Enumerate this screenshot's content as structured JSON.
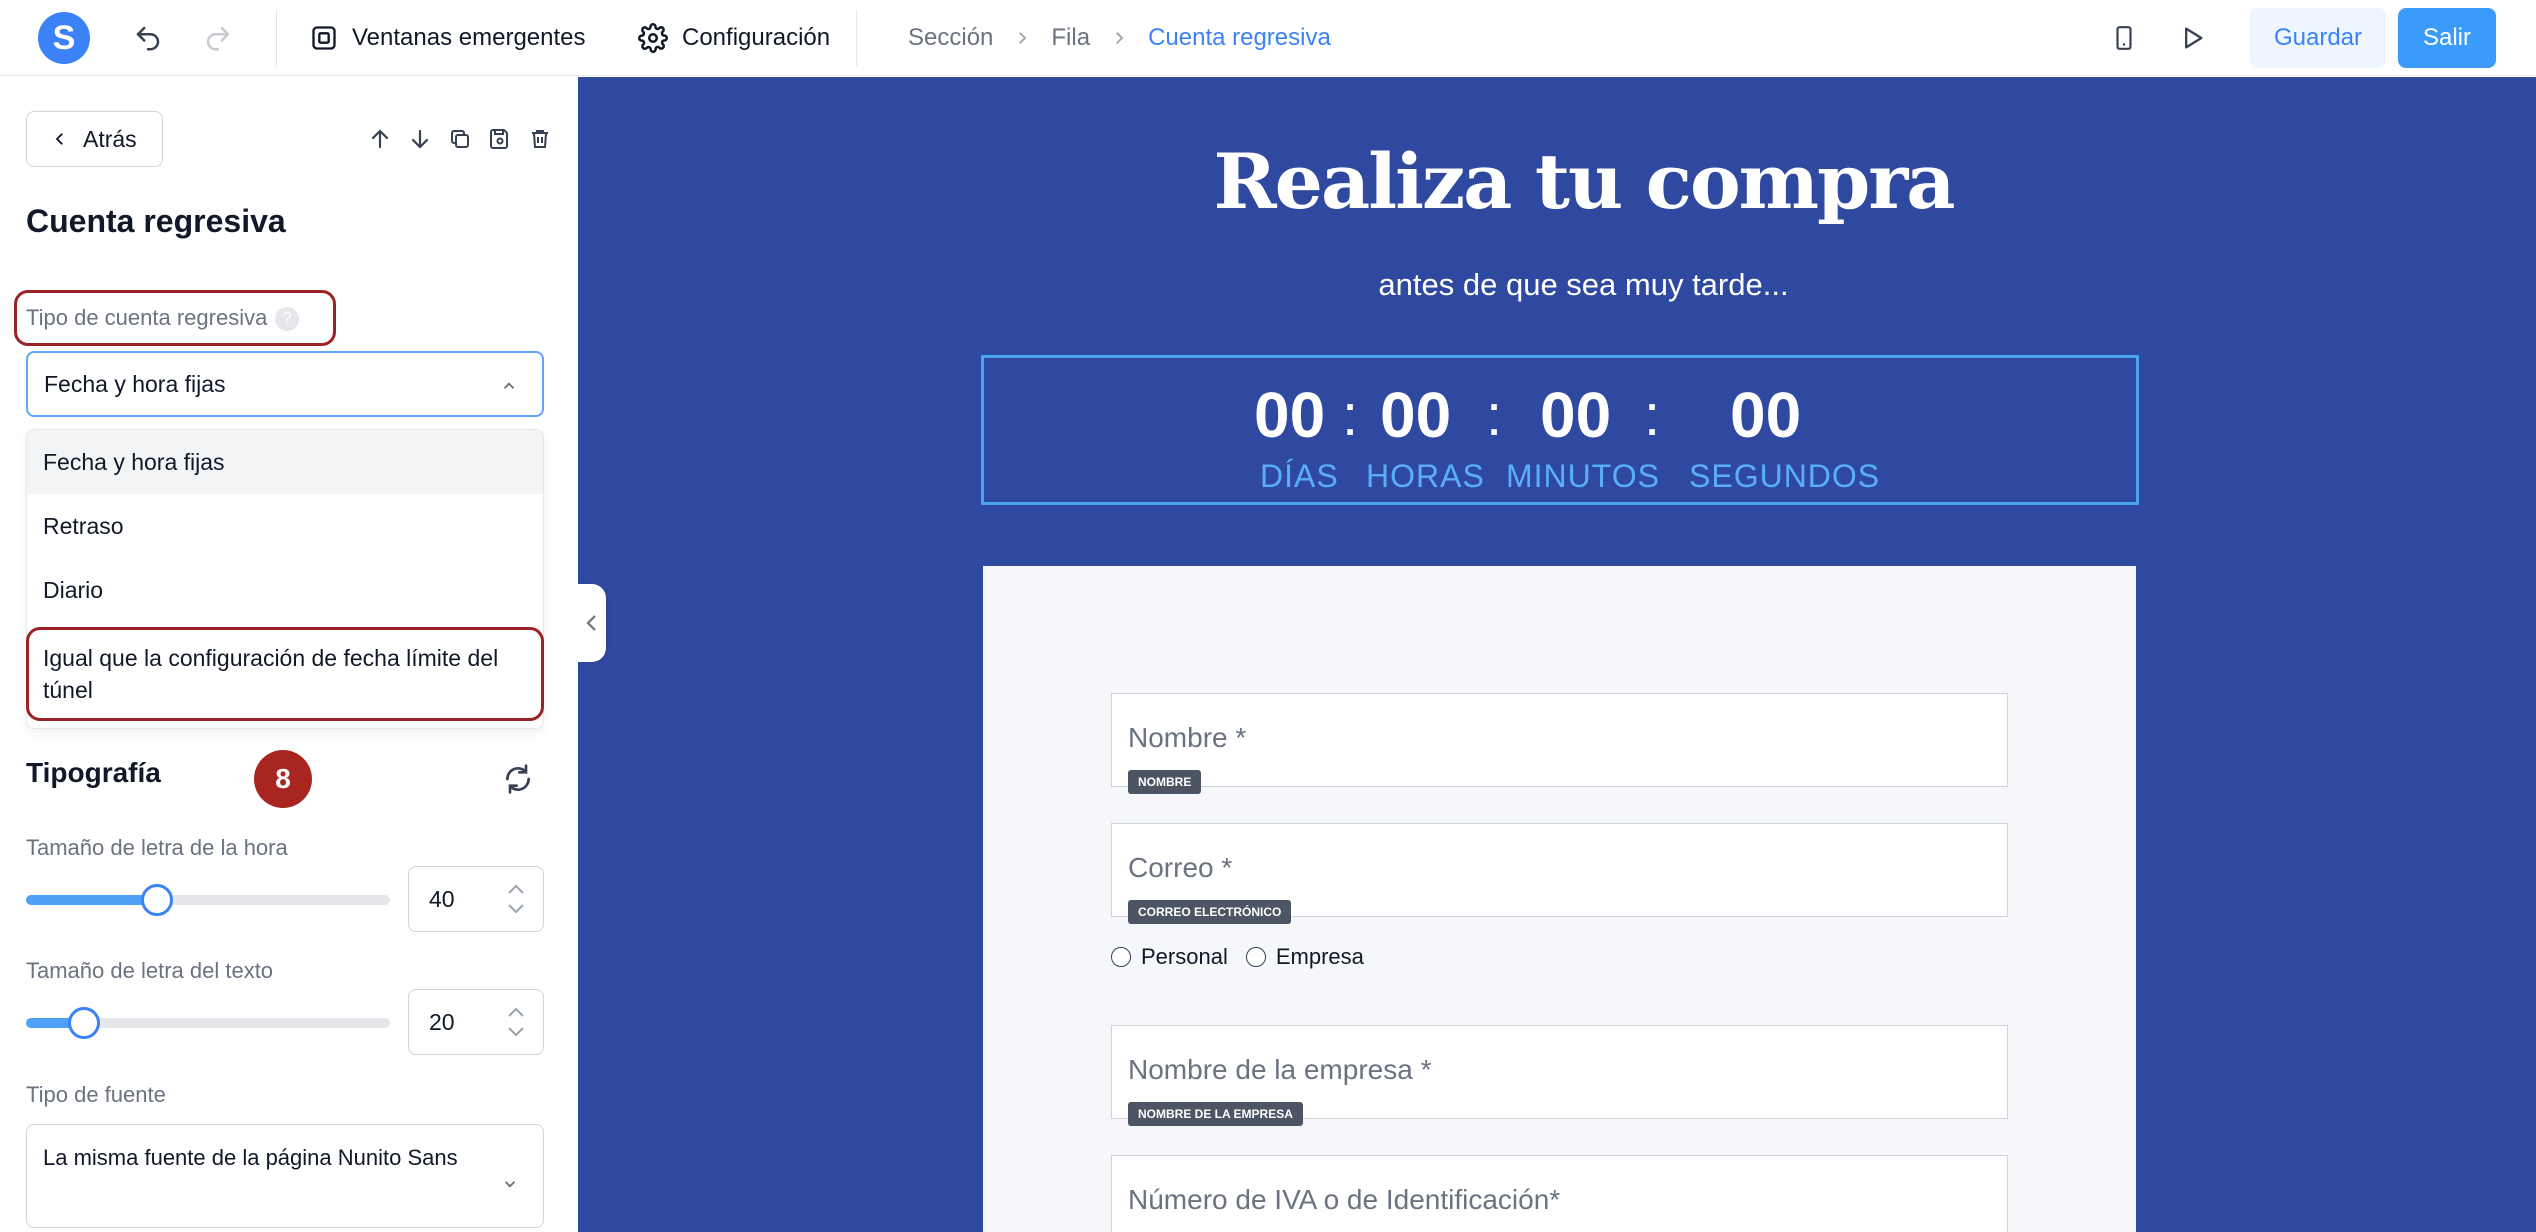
{
  "topbar": {
    "logo_letter": "S",
    "popups_label": "Ventanas emergentes",
    "settings_label": "Configuración",
    "breadcrumb": [
      "Sección",
      "Fila",
      "Cuenta regresiva"
    ],
    "save_label": "Guardar",
    "exit_label": "Salir"
  },
  "panel": {
    "back_label": "Atrás",
    "title": "Cuenta regresiva",
    "countdown_type_label": "Tipo de cuenta regresiva",
    "help_glyph": "?",
    "selected_value": "Fecha y hora fijas",
    "options": [
      "Fecha y hora fijas",
      "Retraso",
      "Diario",
      "Igual que la configuración de fecha límite del túnel"
    ],
    "step_badge": "8",
    "typography_title": "Tipografía",
    "hour_font_label": "Tamaño de letra de la hora",
    "hour_font_value": "40",
    "hour_font_slider_fraction": 0.36,
    "text_font_label": "Tamaño de letra del texto",
    "text_font_value": "20",
    "text_font_slider_fraction": 0.16,
    "font_type_label": "Tipo de fuente",
    "font_type_value": "La misma fuente de la página Nunito Sans"
  },
  "preview": {
    "title": "Realiza tu compra",
    "subtitle": "antes de que sea muy tarde...",
    "countdown": {
      "days": "00",
      "hours": "00",
      "minutes": "00",
      "seconds": "00",
      "sep": ":",
      "days_label": "DÍAS",
      "hours_label": "HORAS",
      "minutes_label": "MINUTOS",
      "seconds_label": "SEGUNDOS"
    },
    "form": {
      "name_placeholder": "Nombre *",
      "name_tag": "NOMBRE",
      "email_placeholder": "Correo *",
      "email_tag": "CORREO ELECTRÓNICO",
      "radio_personal": "Personal",
      "radio_company": "Empresa",
      "company_placeholder": "Nombre de la empresa *",
      "company_tag": "NOMBRE DE LA EMPRESA",
      "vat_placeholder": "Número de IVA o de Identificación*"
    }
  },
  "colors": {
    "accent": "#3b82f6",
    "canvas_bg": "#2f49a0",
    "annotation_red": "#9b2226",
    "badge_red": "#a8261f"
  }
}
